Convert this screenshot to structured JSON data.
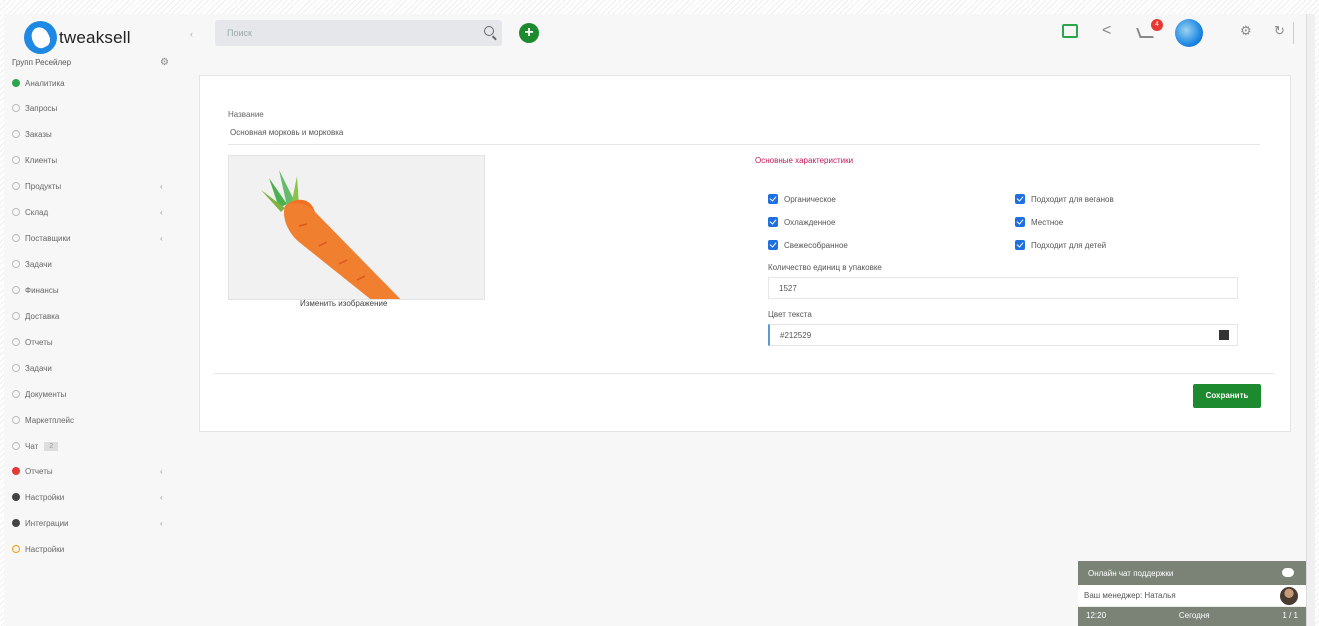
{
  "header": {
    "logo_text": "tweaksell",
    "search_placeholder": "Поиск",
    "add_label": "+",
    "notification_count": "4"
  },
  "sidebar": {
    "title": "Групп Ресейлер",
    "items": [
      {
        "label": "Аналитика",
        "icon": "green",
        "arrow": ""
      },
      {
        "label": "Запросы",
        "icon": "circle",
        "arrow": ""
      },
      {
        "label": "Заказы",
        "icon": "circle",
        "arrow": ""
      },
      {
        "label": "Клиенты",
        "icon": "circle",
        "arrow": ""
      },
      {
        "label": "Продукты",
        "icon": "circle",
        "arrow": "‹"
      },
      {
        "label": "Склад",
        "icon": "circle",
        "arrow": "‹"
      },
      {
        "label": "Поставщики",
        "icon": "circle",
        "arrow": "‹"
      },
      {
        "label": "Задачи",
        "icon": "circle",
        "arrow": ""
      },
      {
        "label": "Финансы",
        "icon": "circle",
        "arrow": ""
      },
      {
        "label": "Доставка",
        "icon": "circle",
        "arrow": ""
      },
      {
        "label": "Отчеты",
        "icon": "circle",
        "arrow": ""
      },
      {
        "label": "Задачи",
        "icon": "circle",
        "arrow": ""
      },
      {
        "label": "Документы",
        "icon": "circle",
        "arrow": ""
      },
      {
        "label": "Маркетплейс",
        "icon": "circle",
        "arrow": ""
      },
      {
        "label": "Чат",
        "icon": "circle",
        "arrow": "",
        "badge": "2"
      },
      {
        "label": "Отчеты",
        "icon": "red",
        "arrow": "‹"
      },
      {
        "label": "Настройки",
        "icon": "dark",
        "arrow": "‹"
      },
      {
        "label": "Интеграции",
        "icon": "dark",
        "arrow": "‹"
      },
      {
        "label": "Настройки",
        "icon": "orange",
        "arrow": ""
      }
    ]
  },
  "form": {
    "name_label": "Название",
    "name_value": "Основная морковь и морковка",
    "change_image_label": "Изменить изображение",
    "features_title": "Основные характеристики",
    "checkboxes_left": [
      "Органическое",
      "Охлажденное",
      "Свежесобранное"
    ],
    "checkboxes_right": [
      "Подходит для веганов",
      "Местное",
      "Подходит для детей"
    ],
    "quantity_label": "Количество единиц в упаковке",
    "quantity_value": "1527",
    "color_label": "Цвет текста",
    "color_value": "#212529",
    "save_label": "Сохранить"
  },
  "chat": {
    "head_label": "Онлайн чат поддержки",
    "row_label": "Ваш менеджер: Наталья",
    "foot_left": "12:20",
    "foot_mid": "Сегодня",
    "foot_right": "1 / 1"
  },
  "colors": {
    "accent_green": "#1e8a2f",
    "features_pink": "#c2185b",
    "checkbox_blue": "#1e6fe0"
  }
}
